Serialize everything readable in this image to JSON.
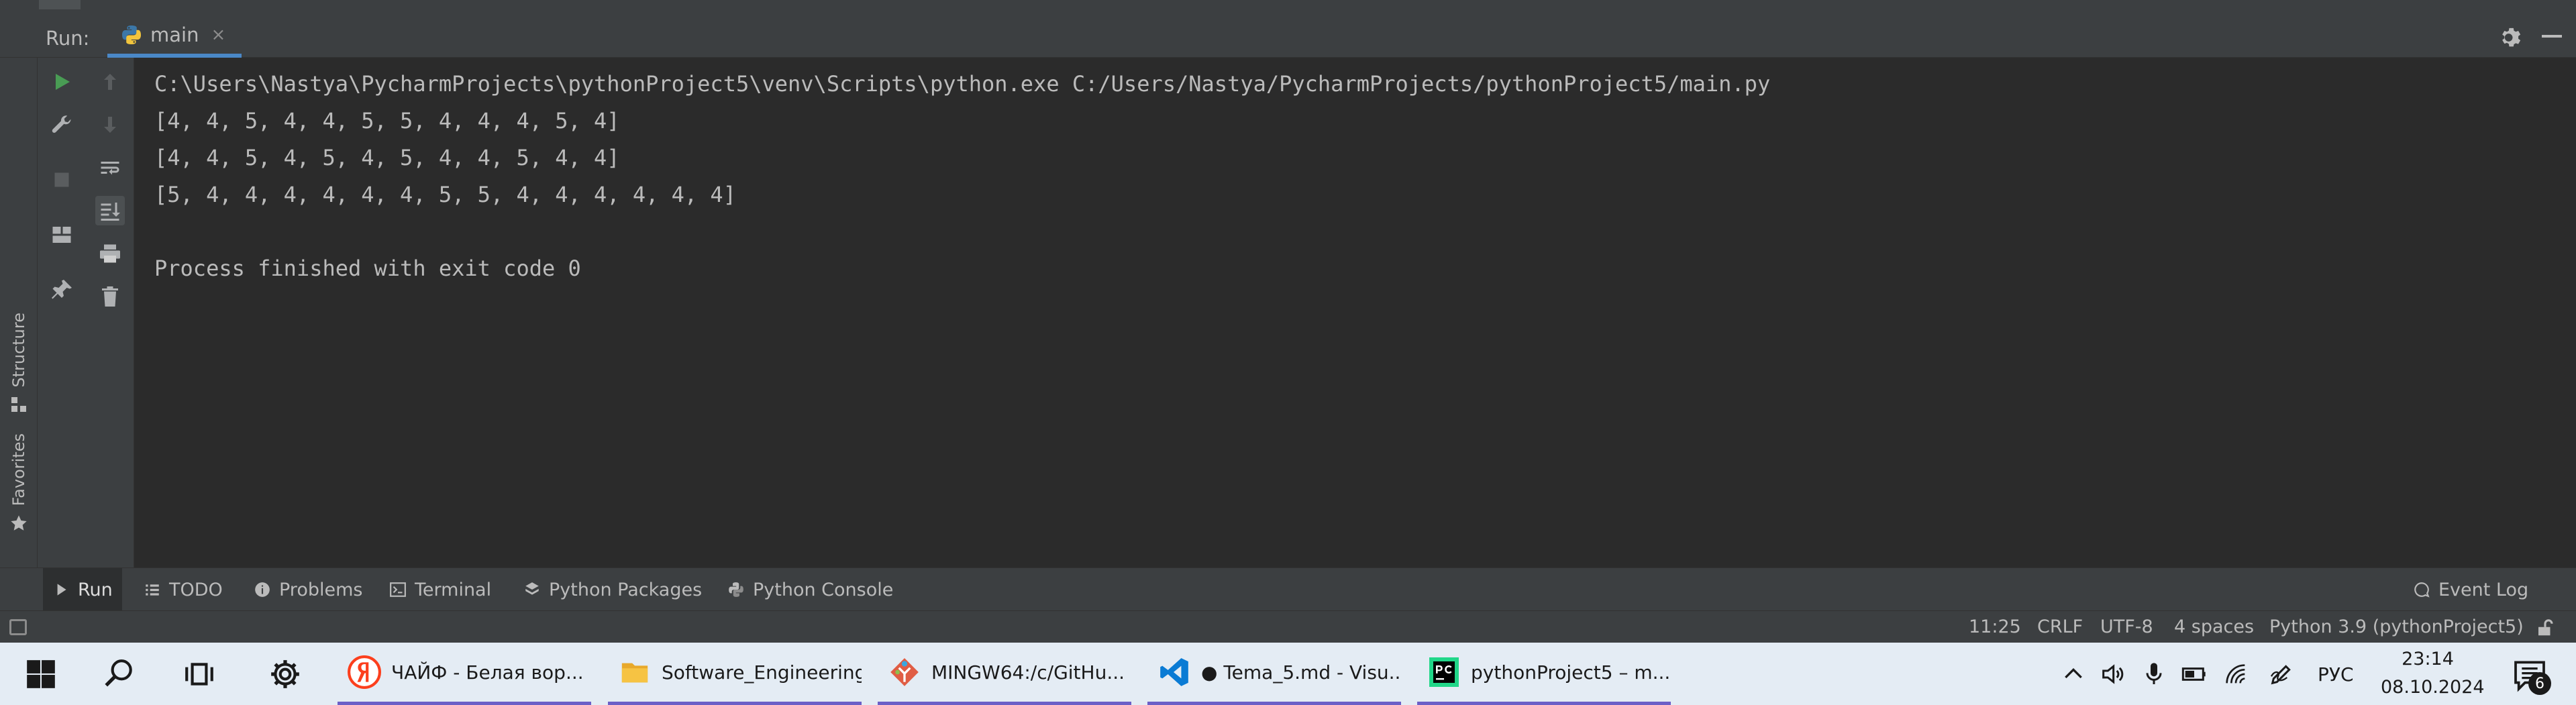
{
  "run_header": {
    "label": "Run:",
    "tab_name": "main",
    "tab_close": "×"
  },
  "sidebar": {
    "structure": "Structure",
    "favorites": "Favorites"
  },
  "console": {
    "lines": [
      "C:\\Users\\Nastya\\PycharmProjects\\pythonProject5\\venv\\Scripts\\python.exe C:/Users/Nastya/PycharmProjects/pythonProject5/main.py",
      "[4, 4, 5, 4, 4, 5, 5, 4, 4, 4, 5, 4]",
      "[4, 4, 5, 4, 5, 4, 5, 4, 4, 5, 4, 4]",
      "[5, 4, 4, 4, 4, 4, 4, 5, 5, 4, 4, 4, 4, 4, 4]",
      "",
      "Process finished with exit code 0"
    ]
  },
  "tool_windows": {
    "run": "Run",
    "todo": "TODO",
    "problems": "Problems",
    "terminal": "Terminal",
    "python_packages": "Python Packages",
    "python_console": "Python Console",
    "event_log": "Event Log"
  },
  "status_bar": {
    "position": "11:25",
    "line_separator": "CRLF",
    "encoding": "UTF-8",
    "indent": "4 spaces",
    "interpreter": "Python 3.9 (pythonProject5)"
  },
  "taskbar": {
    "apps": {
      "yandex": "ЧАЙФ - Белая вор...",
      "explorer": "Software_Engineering",
      "git": "MINGW64:/c/GitHu...",
      "vscode": "● Tema_5.md - Visu...",
      "pycharm": "pythonProject5 – m..."
    },
    "language": "РУС",
    "time": "23:14",
    "date": "08.10.2024",
    "notifications": "6"
  },
  "colors": {
    "accent": "#4a88c7",
    "run_green": "#499c54",
    "taskbar_underline": "#6c5fc7"
  }
}
